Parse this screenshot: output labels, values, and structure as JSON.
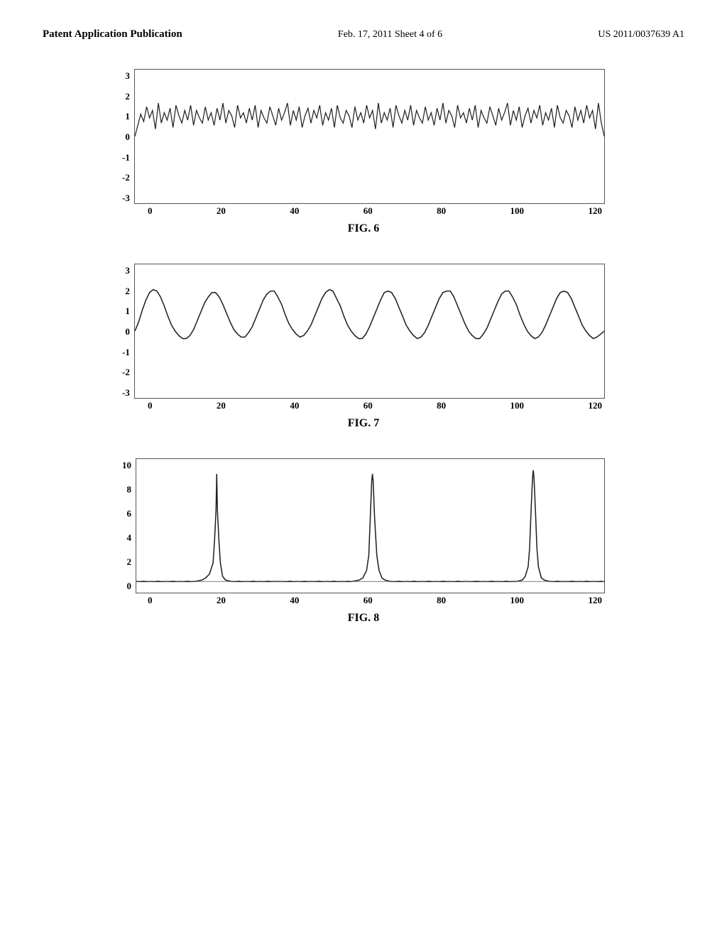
{
  "header": {
    "left": "Patent Application Publication",
    "center": "Feb. 17, 2011   Sheet 4 of 6",
    "right": "US 2011/0037639 A1"
  },
  "figures": [
    {
      "id": "fig6",
      "caption": "FIG. 6",
      "yLabels": [
        "3",
        "2",
        "1",
        "0",
        "-1",
        "-2",
        "-3"
      ],
      "xLabels": [
        "0",
        "20",
        "40",
        "60",
        "80",
        "100",
        "120"
      ],
      "type": "noisy_wave"
    },
    {
      "id": "fig7",
      "caption": "FIG. 7",
      "yLabels": [
        "3",
        "2",
        "1",
        "0",
        "-1",
        "-2",
        "-3"
      ],
      "xLabels": [
        "0",
        "20",
        "40",
        "60",
        "80",
        "100",
        "120"
      ],
      "type": "clean_wave"
    },
    {
      "id": "fig8",
      "caption": "FIG. 8",
      "yLabels": [
        "10",
        "8",
        "6",
        "4",
        "2",
        "0"
      ],
      "xLabels": [
        "0",
        "20",
        "40",
        "60",
        "80",
        "100",
        "120"
      ],
      "type": "spikes"
    }
  ]
}
